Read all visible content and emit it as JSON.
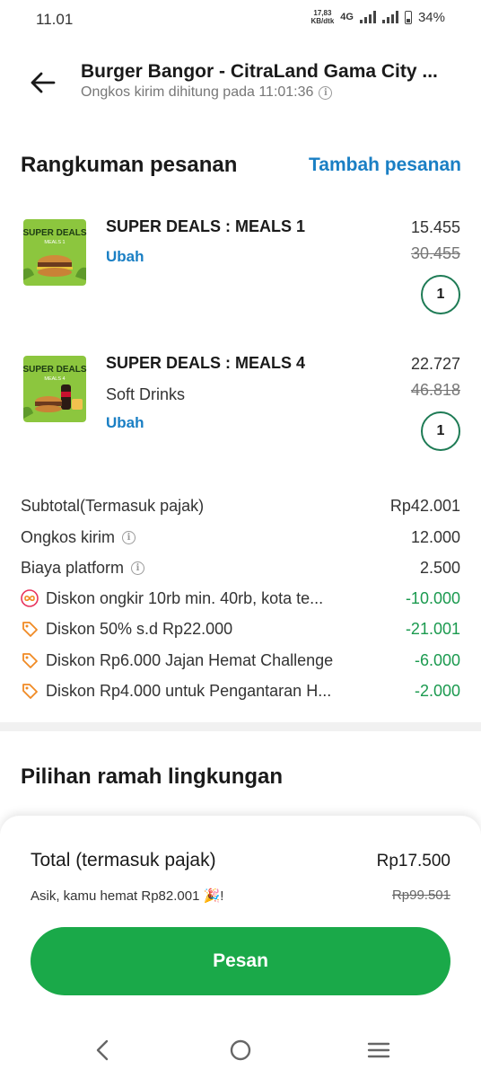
{
  "status_bar": {
    "time": "11.01",
    "net_speed_top": "17,83",
    "net_speed_bottom": "KB/dtk",
    "network": "4G",
    "battery": "34%"
  },
  "header": {
    "store_name": "Burger Bangor - CitraLand Gama City ...",
    "delivery_note": "Ongkos kirim dihitung pada 11:01:36",
    "info_icon": "i"
  },
  "summary": {
    "title": "Rangkuman pesanan",
    "add_order": "Tambah pesanan",
    "items": [
      {
        "name": "SUPER DEALS : MEALS 1",
        "option": "",
        "edit": "Ubah",
        "price": "15.455",
        "original_price": "30.455",
        "quantity": "1",
        "thumb_title": "SUPER DEALS",
        "thumb_sub": "MEALS 1"
      },
      {
        "name": "SUPER DEALS : MEALS 4",
        "option": "Soft Drinks",
        "edit": "Ubah",
        "price": "22.727",
        "original_price": "46.818",
        "quantity": "1",
        "thumb_title": "SUPER DEALS",
        "thumb_sub": "MEALS 4"
      }
    ]
  },
  "breakdown": {
    "subtotal_label": "Subtotal(Termasuk pajak)",
    "subtotal_value": "Rp42.001",
    "delivery_label": "Ongkos kirim",
    "delivery_value": "12.000",
    "platform_label": "Biaya platform",
    "platform_value": "2.500",
    "discounts": [
      {
        "label": "Diskon ongkir 10rb min. 40rb, kota te...",
        "value": "-10.000",
        "icon": "infinity-promo-icon"
      },
      {
        "label": "Diskon 50% s.d Rp22.000",
        "value": "-21.001",
        "icon": "tag-icon"
      },
      {
        "label": "Diskon Rp6.000 Jajan Hemat Challenge",
        "value": "-6.000",
        "icon": "tag-icon"
      },
      {
        "label": "Diskon Rp4.000 untuk Pengantaran H...",
        "value": "-2.000",
        "icon": "tag-icon"
      }
    ]
  },
  "eco": {
    "title": "Pilihan ramah lingkungan"
  },
  "checkout": {
    "total_label": "Total (termasuk pajak)",
    "total_value": "Rp17.500",
    "saved_text": "Asik, kamu hemat Rp82.001 🎉!",
    "original_total": "Rp99.501",
    "order_button": "Pesan"
  },
  "colors": {
    "accent_green": "#1aa949",
    "link_blue": "#1a7fc4",
    "discount_green": "#1b9a4f",
    "discount_orange": "#f08a24"
  }
}
